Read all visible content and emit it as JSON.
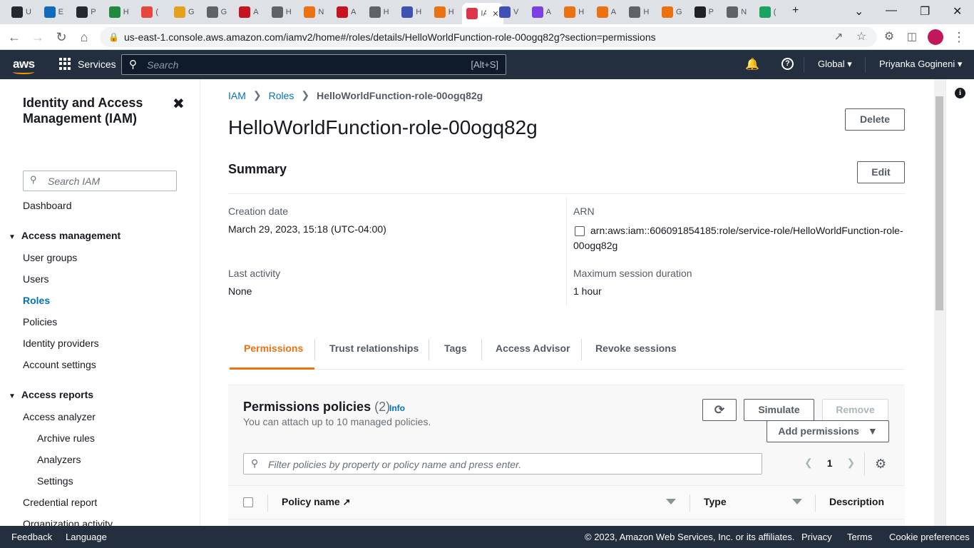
{
  "browser": {
    "tabs": [
      {
        "icon": "github-icon",
        "label": "U",
        "color": "#24292f"
      },
      {
        "icon": "outlook-icon",
        "label": "E",
        "color": "#0f6cbd"
      },
      {
        "icon": "github-icon",
        "label": "P",
        "color": "#24292f"
      },
      {
        "icon": "w-icon",
        "label": "H",
        "color": "#1e8a3c"
      },
      {
        "icon": "badge-icon",
        "label": "(",
        "color": "#e8453c"
      },
      {
        "icon": "box-icon",
        "label": "G",
        "color": "#e4a11b"
      },
      {
        "icon": "globe-icon",
        "label": "G",
        "color": "#5f6368"
      },
      {
        "icon": "aws-warn-icon",
        "label": "A",
        "color": "#c7131f"
      },
      {
        "icon": "globe-icon",
        "label": "H",
        "color": "#5f6368"
      },
      {
        "icon": "cube-icon",
        "label": "N",
        "color": "#ec7211"
      },
      {
        "icon": "aws-warn-icon",
        "label": "A",
        "color": "#c7131f"
      },
      {
        "icon": "globe-icon",
        "label": "H",
        "color": "#5f6368"
      },
      {
        "icon": "doc-icon",
        "label": "H",
        "color": "#3f51b5"
      },
      {
        "icon": "lambda-icon",
        "label": "H",
        "color": "#ec7211"
      },
      {
        "icon": "iam-icon",
        "label": "IA",
        "color": "#dd344c"
      },
      {
        "icon": "doc-icon",
        "label": "V",
        "color": "#3f51b5"
      },
      {
        "icon": "m-icon",
        "label": "A",
        "color": "#7b3fe4"
      },
      {
        "icon": "lambda-icon",
        "label": "H",
        "color": "#ec7211"
      },
      {
        "icon": "lambda-icon",
        "label": "A",
        "color": "#ec7211"
      },
      {
        "icon": "globe-icon",
        "label": "H",
        "color": "#5f6368"
      },
      {
        "icon": "lambda-icon",
        "label": "G",
        "color": "#ec7211"
      },
      {
        "icon": "openai-icon",
        "label": "P",
        "color": "#202124"
      },
      {
        "icon": "chrome-icon",
        "label": "N",
        "color": "#5f6368"
      },
      {
        "icon": "one-icon",
        "label": "(",
        "color": "#1aa260"
      }
    ],
    "url": "us-east-1.console.aws.amazon.com/iamv2/home#/roles/details/HelloWorldFunction-role-00ogq82g?section=permissions"
  },
  "aws_nav": {
    "logo": "aws",
    "services_label": "Services",
    "search_placeholder": "Search",
    "search_hint": "[Alt+S]",
    "region": "Global",
    "user": "Priyanka Gogineni"
  },
  "sidebar": {
    "title": "Identity and Access Management (IAM)",
    "search_placeholder": "Search IAM",
    "dashboard": "Dashboard",
    "access_management": {
      "heading": "Access management",
      "items": [
        "User groups",
        "Users",
        "Roles",
        "Policies",
        "Identity providers",
        "Account settings"
      ]
    },
    "access_reports": {
      "heading": "Access reports",
      "items": [
        "Access analyzer",
        "Archive rules",
        "Analyzers",
        "Settings",
        "Credential report",
        "Organization activity"
      ]
    }
  },
  "breadcrumb": {
    "root": "IAM",
    "section": "Roles",
    "current": "HelloWorldFunction-role-00ogq82g"
  },
  "page": {
    "title": "HelloWorldFunction-role-00ogq82g",
    "delete_label": "Delete",
    "edit_label": "Edit",
    "summary_heading": "Summary"
  },
  "summary": {
    "creation_date_label": "Creation date",
    "creation_date": "March 29, 2023, 15:18 (UTC-04:00)",
    "last_activity_label": "Last activity",
    "last_activity": "None",
    "arn_label": "ARN",
    "arn": "arn:aws:iam::606091854185:role/service-role/HelloWorldFunction-role-00ogq82g",
    "max_session_label": "Maximum session duration",
    "max_session": "1 hour"
  },
  "tabs": [
    "Permissions",
    "Trust relationships",
    "Tags",
    "Access Advisor",
    "Revoke sessions"
  ],
  "permissions": {
    "heading": "Permissions policies",
    "count": "(2)",
    "info": "Info",
    "subtitle": "You can attach up to 10 managed policies.",
    "simulate_label": "Simulate",
    "remove_label": "Remove",
    "add_label": "Add permissions",
    "filter_placeholder": "Filter policies by property or policy name and press enter.",
    "page": "1",
    "columns": [
      "Policy name",
      "Type",
      "Description"
    ]
  },
  "footer": {
    "feedback": "Feedback",
    "language": "Language",
    "copyright": "© 2023, Amazon Web Services, Inc. or its affiliates.",
    "privacy": "Privacy",
    "terms": "Terms",
    "cookies": "Cookie preferences"
  }
}
